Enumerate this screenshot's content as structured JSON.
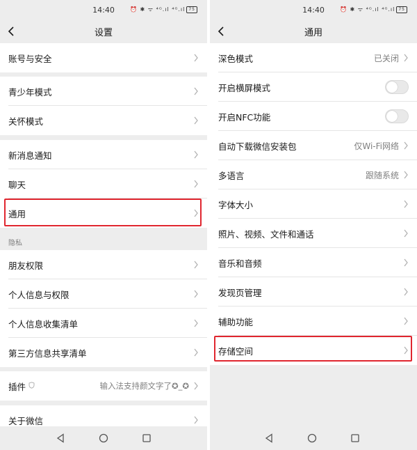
{
  "left": {
    "status": {
      "time": "14:40",
      "icons": "⏰ ✱ ᯤ ⁴ᴳ.ıl ⁴ᴳ.ıl",
      "battery": "75"
    },
    "title": "设置",
    "rows": {
      "account": "账号与安全",
      "teen": "青少年模式",
      "care": "关怀模式",
      "notify": "新消息通知",
      "chat": "聊天",
      "general": "通用",
      "friend_perm": "朋友权限",
      "personal_info": "个人信息与权限",
      "collect_list": "个人信息收集清单",
      "third_party": "第三方信息共享清单",
      "plugin": "插件",
      "plugin_value": "输入法支持颜文字了✪_✪",
      "about": "关于微信"
    },
    "privacy_section": "隐私"
  },
  "right": {
    "status": {
      "time": "14:40",
      "icons": "⏰ ✱ ᯤ ⁴ᴳ.ıl ⁴ᴳ.ıl",
      "battery": "75"
    },
    "title": "通用",
    "rows": {
      "dark_mode": "深色模式",
      "dark_mode_value": "已关闭",
      "landscape": "开启横屏模式",
      "nfc": "开启NFC功能",
      "auto_download": "自动下载微信安装包",
      "auto_download_value": "仅Wi-Fi网络",
      "language": "多语言",
      "language_value": "跟随系统",
      "font_size": "字体大小",
      "media": "照片、视频、文件和通话",
      "music": "音乐和音频",
      "discover": "发现页管理",
      "accessibility": "辅助功能",
      "storage": "存储空间"
    },
    "toggles": {
      "landscape_on": false,
      "nfc_on": false
    }
  },
  "colors": {
    "highlight": "#e0262f",
    "background": "#ededed",
    "card": "#ffffff"
  },
  "icons": [
    "back-icon",
    "chevron-right-icon",
    "shield-icon",
    "nav-back-icon",
    "nav-home-icon",
    "nav-recents-icon"
  ]
}
